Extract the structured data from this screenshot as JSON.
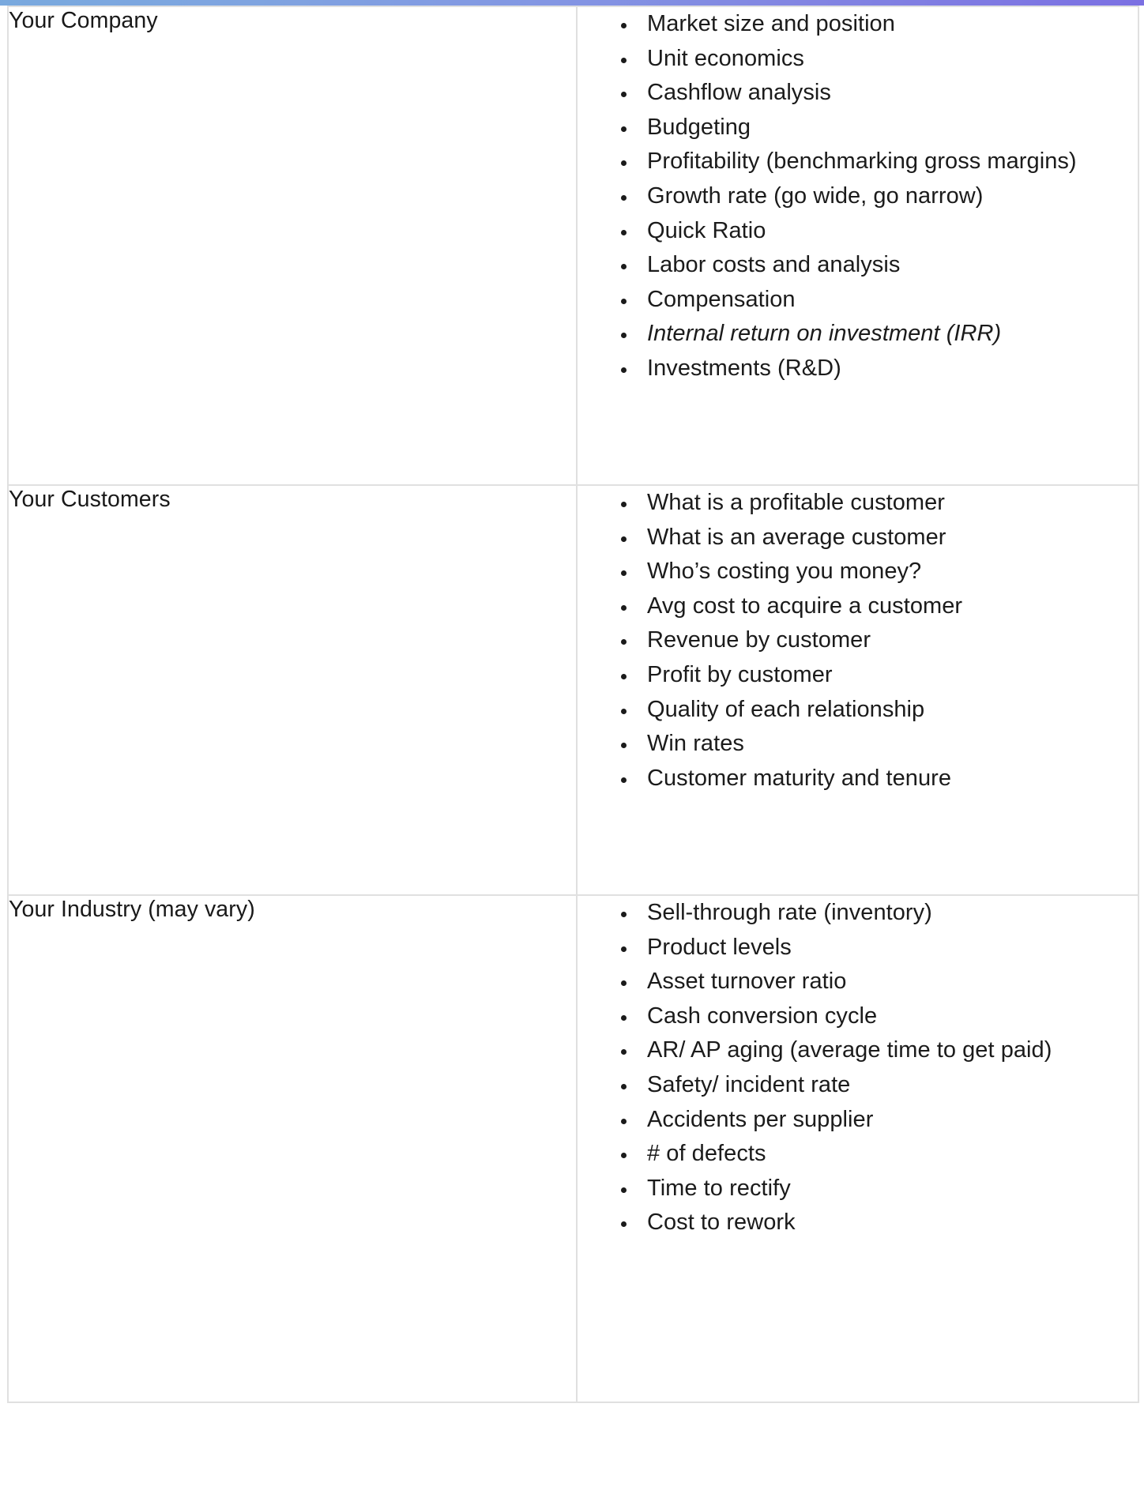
{
  "decoration": {
    "top_bar_gradient_start": "#79a9de",
    "top_bar_gradient_end": "#7b70e2",
    "border_color": "#e0e0e0",
    "text_color": "#1b1b1b"
  },
  "table": {
    "rows": [
      {
        "label": "Your Company",
        "items": [
          {
            "text": "Market size and position",
            "italic": false
          },
          {
            "text": "Unit economics",
            "italic": false
          },
          {
            "text": "Cashflow analysis",
            "italic": false
          },
          {
            "text": "Budgeting",
            "italic": false
          },
          {
            "text": "Profitability (benchmarking gross margins)",
            "italic": false
          },
          {
            "text": "Growth rate (go wide, go narrow)",
            "italic": false
          },
          {
            "text": "Quick Ratio",
            "italic": false
          },
          {
            "text": "Labor costs and analysis",
            "italic": false
          },
          {
            "text": "Compensation",
            "italic": false
          },
          {
            "text": "Internal return on investment (IRR)",
            "italic": true
          },
          {
            "text": "Investments (R&D)",
            "italic": false
          }
        ]
      },
      {
        "label": "Your Customers",
        "items": [
          {
            "text": "What is a profitable customer",
            "italic": false
          },
          {
            "text": "What is an average customer",
            "italic": false
          },
          {
            "text": "Who’s costing you money?",
            "italic": false
          },
          {
            "text": "Avg cost to acquire a customer",
            "italic": false
          },
          {
            "text": "Revenue by customer",
            "italic": false
          },
          {
            "text": "Profit by customer",
            "italic": false
          },
          {
            "text": "Quality of each relationship",
            "italic": false
          },
          {
            "text": "Win rates",
            "italic": false
          },
          {
            "text": "Customer maturity and tenure",
            "italic": false
          }
        ]
      },
      {
        "label": "Your Industry (may vary)",
        "items": [
          {
            "text": "Sell-through rate (inventory)",
            "italic": false
          },
          {
            "text": "Product levels",
            "italic": false
          },
          {
            "text": "Asset turnover ratio",
            "italic": false
          },
          {
            "text": "Cash conversion cycle",
            "italic": false
          },
          {
            "text": "AR/ AP aging (average time to get paid)",
            "italic": false
          },
          {
            "text": "Safety/ incident rate",
            "italic": false
          },
          {
            "text": "Accidents per supplier",
            "italic": false
          },
          {
            "text": "# of defects",
            "italic": false
          },
          {
            "text": "Time to rectify",
            "italic": false
          },
          {
            "text": "Cost to rework",
            "italic": false
          }
        ]
      }
    ]
  }
}
